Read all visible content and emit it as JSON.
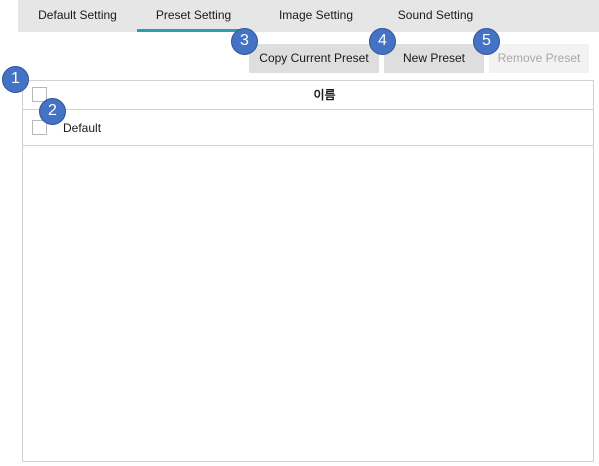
{
  "tabs": [
    {
      "label": "Default Setting",
      "selected": false
    },
    {
      "label": "Preset Setting",
      "selected": true
    },
    {
      "label": "Image Setting",
      "selected": false
    },
    {
      "label": "Sound Setting",
      "selected": false
    }
  ],
  "toolbar": {
    "copy_current_preset_label": "Copy Current Preset",
    "new_preset_label": "New Preset",
    "remove_preset_label": "Remove Preset",
    "remove_preset_enabled": false
  },
  "preset_list": {
    "header_label": "이름",
    "select_all_checked": false,
    "rows": [
      {
        "name": "Default",
        "checked": false
      }
    ]
  },
  "callouts": [
    "1",
    "2",
    "3",
    "4",
    "5"
  ],
  "colors": {
    "tab_bar_background": "#e6e6e6",
    "selected_tab_underline": "#2e9db1",
    "button_background": "#dedede",
    "disabled_button_background": "#f2f2f2",
    "disabled_text": "#a8a8a8",
    "callout_fill": "#4472c4",
    "callout_border": "#2f5597",
    "grid_line": "#d2d2d2"
  }
}
